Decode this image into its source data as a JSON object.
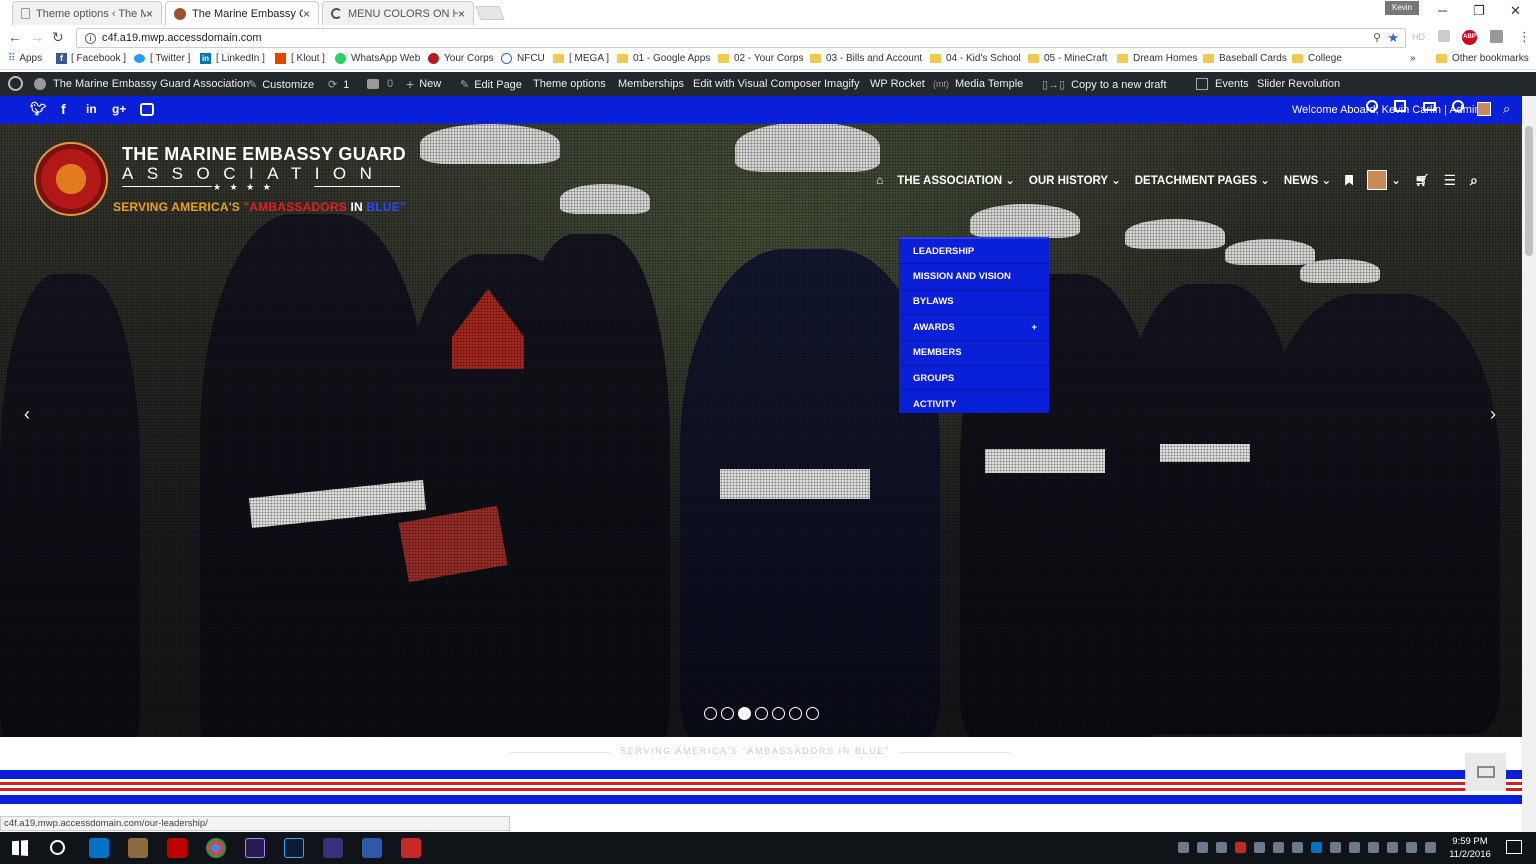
{
  "browser": {
    "tabs": [
      {
        "title": "Theme options ‹ The Ma",
        "close": "×"
      },
      {
        "title": "The Marine Embassy Gu",
        "close": "×"
      },
      {
        "title": "MENU COLORS ON HOV",
        "close": "×"
      }
    ],
    "profile": "Kevin",
    "window_min": "─",
    "window_restore": "❐",
    "window_close": "✕",
    "url": "c4f.a19.mwp.accessdomain.com",
    "hd_label": "HD",
    "abp_label": "ABP"
  },
  "bookmarks": {
    "items": [
      "Apps",
      "[ Facebook ]",
      "[ Twitter ]",
      "[ LinkedIn ]",
      "[ Klout ]",
      "WhatsApp Web",
      "Your Corps",
      "NFCU",
      "[ MEGA ]",
      "01 - Google Apps",
      "02 - Your Corps",
      "03 - Bills and Account",
      "04 - Kid's School",
      "05 - MineCraft",
      "Dream Homes",
      "Baseball Cards",
      "College"
    ],
    "overflow": "»",
    "other": "Other bookmarks"
  },
  "wp_admin": {
    "site_name": "The Marine Embassy Guard Association",
    "customize": "Customize",
    "updates": "1",
    "comments": "0",
    "new": "New",
    "edit_page": "Edit Page",
    "theme_options": "Theme options",
    "memberships": "Memberships",
    "visual_composer": "Edit with Visual Composer",
    "imagify": "Imagify",
    "wp_rocket": "WP Rocket",
    "media_temple": "Media Temple",
    "copy_draft": "Copy to a new draft",
    "events": "Events",
    "slider_revolution": "Slider Revolution"
  },
  "social": {
    "icons": [
      "twitter-icon",
      "facebook-icon",
      "linkedin-icon",
      "google-plus-icon",
      "youtube-icon"
    ],
    "welcome": "Welcome Aboard, Kevin Carlin | Admin"
  },
  "site": {
    "brand_line1": "THE MARINE EMBASSY GUARD",
    "brand_line2": "ASSOCIATION",
    "stars": "★ ★ ★ ★",
    "tagline_a": "SERVING AMERICA'S ",
    "tagline_b": "\"AMBASSADORS",
    "tagline_c": " IN ",
    "tagline_d": "BLUE\"",
    "nav": [
      "THE ASSOCIATION",
      "OUR HISTORY",
      "DETACHMENT PAGES",
      "NEWS"
    ],
    "dropdown": [
      "LEADERSHIP",
      "MISSION AND VISION",
      "BYLAWS",
      "AWARDS",
      "MEMBERS",
      "GROUPS",
      "ACTIVITY"
    ],
    "awards_plus": "+",
    "prev": "‹",
    "next": "›",
    "slides_count": 7,
    "active_slide": 3,
    "section_tagline": "SERVING AMERICA'S \"AMBASSADORS IN BLUE\""
  },
  "status_url": "c4f.a19.mwp.accessdomain.com/our-leadership/",
  "taskbar": {
    "time": "9:59 PM",
    "date": "11/2/2016"
  },
  "colors": {
    "brand_blue": "#0a1fd8",
    "wp_bar": "#23282d",
    "gold": "#e8a317",
    "red": "#d21f1f"
  }
}
